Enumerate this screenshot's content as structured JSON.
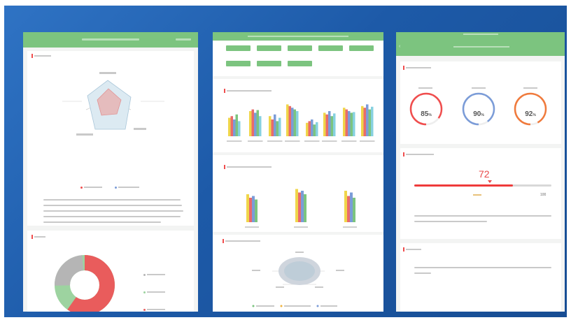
{
  "colors": {
    "frame": "#1f5dab",
    "header_green": "#7cc47f",
    "red": "#f04d4d",
    "blue": "#7b9cd8",
    "orange": "#f07a3c"
  },
  "screen3": {
    "gauges": [
      {
        "value": "85",
        "unit": "%",
        "color": "#f04d4d",
        "fraction": 0.85
      },
      {
        "value": "90",
        "unit": "%",
        "color": "#7b9cd8",
        "fraction": 0.9
      },
      {
        "value": "92",
        "unit": "%",
        "color": "#f07a3c",
        "fraction": 0.92
      }
    ],
    "slider": {
      "value": "72",
      "max_label": "100",
      "fraction": 0.72
    }
  }
}
